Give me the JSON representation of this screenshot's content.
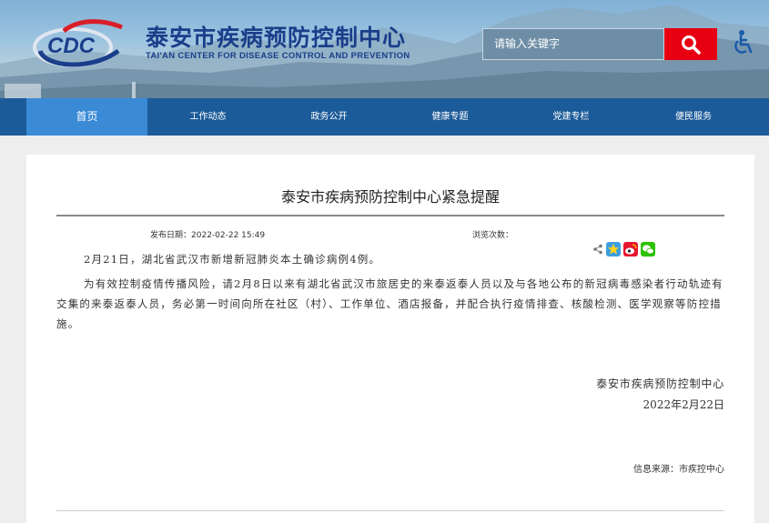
{
  "header": {
    "title": "泰安市疾病预防控制中心",
    "subtitle": "TAI'AN CENTER FOR DISEASE CONTROL AND PREVENTION",
    "logo_text": "CDC",
    "search_placeholder": "请输入关键字",
    "search_icon": "search-icon",
    "accessibility_icon": "wheelchair-icon",
    "accent_color": "#e60012",
    "title_color": "#1a3e8a"
  },
  "nav": {
    "items": [
      {
        "label": "首页"
      },
      {
        "label": "工作动态"
      },
      {
        "label": "政务公开"
      },
      {
        "label": "健康专题"
      },
      {
        "label": "党建专栏"
      },
      {
        "label": "便民服务"
      }
    ],
    "color": "#1c5b99",
    "active_color": "#3a8ad6"
  },
  "article": {
    "title": "泰安市疾病预防控制中心紧急提醒",
    "publish_label": "发布日期：",
    "publish_date": "2022-02-22 15:49",
    "views_label": "浏览次数：",
    "paragraphs": [
      "2月21日，湖北省武汉市新增新冠肺炎本土确诊病例4例。",
      "为有效控制疫情传播风险，请2月8日以来有湖北省武汉市旅居史的来泰返泰人员以及与各地公布的新冠病毒感染者行动轨迹有交集的来泰返泰人员，务必第一时间向所在社区（村）、工作单位、酒店报备，并配合执行疫情排查、核酸检测、医学观察等防控措施。"
    ],
    "signature_org": "泰安市疾病预防控制中心",
    "signature_date": "2022年2月22日",
    "source_label": "信息来源：",
    "source_value": "市疾控中心"
  },
  "share": {
    "icons": [
      "share-icon",
      "qzone-icon",
      "weibo-icon",
      "wechat-icon"
    ]
  }
}
